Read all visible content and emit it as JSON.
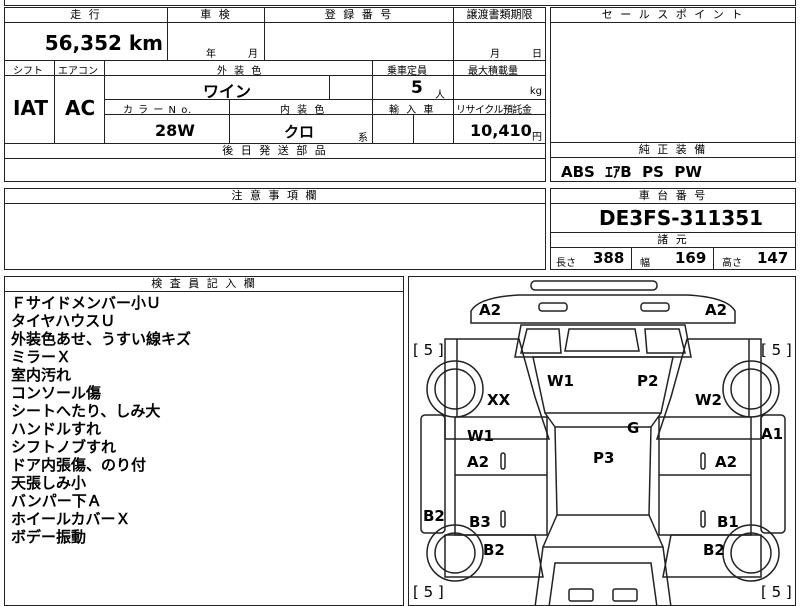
{
  "top_strip": {
    "text": "……"
  },
  "mileage": {
    "header": "走 行",
    "value": "56,352 km"
  },
  "inspection": {
    "header": "車 検",
    "year_label": "年",
    "month_label": "月"
  },
  "registration": {
    "header": "登 録 番 号"
  },
  "transfer": {
    "header": "譲渡書類期限",
    "month_label": "月",
    "day_label": "日"
  },
  "shift": {
    "header": "シフト",
    "value": "IAT"
  },
  "aircon": {
    "header": "エアコン",
    "value": "AC"
  },
  "exterior": {
    "header": "外 装 色",
    "value": "ワイン"
  },
  "capacity": {
    "header": "乗車定員",
    "value": "5",
    "unit": "人"
  },
  "max_load": {
    "header": "最大積載量",
    "unit": "kg"
  },
  "color_no": {
    "header": "カ ラ ー N o.",
    "value": "28W"
  },
  "interior": {
    "header": "内 装 色",
    "value": "クロ",
    "unit": "系"
  },
  "import": {
    "header": "輸 入 車"
  },
  "recycle": {
    "header": "リサイクル預託金",
    "value": "10,410",
    "unit": "円"
  },
  "later_parts": {
    "header": "後 日 発 送 部 品"
  },
  "sales_point": {
    "header": "セ ー ル ス ポ イ ン ト"
  },
  "equipment": {
    "header": "純 正 装 備",
    "value": "ABS  ｴｱB  PS  PW"
  },
  "caution": {
    "header": "注 意 事 項 欄"
  },
  "chassis": {
    "header": "車 台 番 号",
    "value": "DE3FS-311351"
  },
  "specs": {
    "header": "諸 元",
    "length_label": "長さ",
    "length": "388",
    "width_label": "幅",
    "width": "169",
    "height_label": "高さ",
    "height": "147"
  },
  "inspector": {
    "header": "検 査 員 記 入 欄",
    "notes": [
      "Ｆサイドメンバー小Ｕ",
      "タイヤハウスＵ",
      "外装色あせ、うすい線キズ",
      "ミラーＸ",
      "室内汚れ",
      "コンソール傷",
      "シートへたり、しみ大",
      "ハンドルすれ",
      "シフトノブすれ",
      "ドア内張傷、のり付",
      "天張しみ小",
      "バンパー下Ａ",
      "ホイールカバーＸ",
      "ボデー振動"
    ]
  },
  "diagram": {
    "tire_fl": "[ 5 ]",
    "tire_fr": "[ 5 ]",
    "tire_rl": "[ 5 ]",
    "tire_rr": "[ 5 ]",
    "front_left": "A2",
    "front_right": "A2",
    "windshield_left": "W1",
    "windshield_right": "P2",
    "fender_left": "XX",
    "fender_right": "W2",
    "window_left": "W1",
    "door_left_front": "A2",
    "roof": "G",
    "roof_body": "P3",
    "side_right": "A1",
    "door_right_front": "A2",
    "rear_left_side": "B2",
    "door_left_rear": "B3",
    "door_right_rear": "B1",
    "rear_left": "B2",
    "rear_right": "B2"
  }
}
